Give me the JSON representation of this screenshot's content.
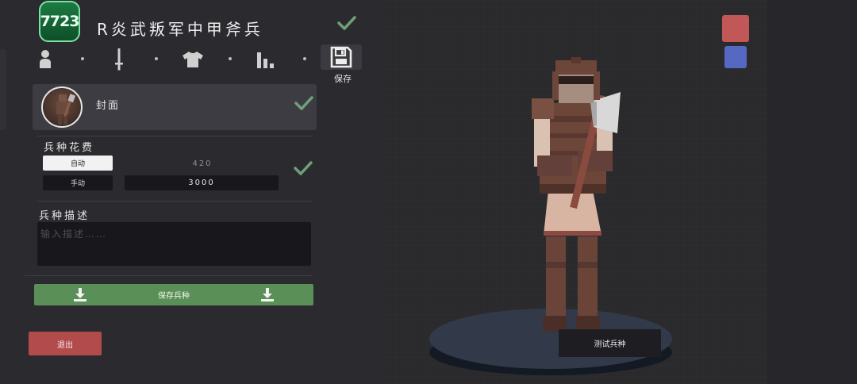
{
  "header": {
    "badge": "7723",
    "title": "R炎武叛军中甲斧兵"
  },
  "tabs": [
    {
      "icon": "person-icon"
    },
    {
      "icon": "sword-icon"
    },
    {
      "icon": "shirt-icon"
    },
    {
      "icon": "stats-icon"
    },
    {
      "icon": "save-disk-icon",
      "label": "保存"
    }
  ],
  "cover": {
    "label": "封面"
  },
  "cost": {
    "label": "兵种花费",
    "auto_label": "自动",
    "manual_label": "手动",
    "auto_value": "420",
    "manual_value": "3000"
  },
  "description": {
    "label": "兵种描述",
    "placeholder": "输入描述……"
  },
  "actions": {
    "save_unit": "保存兵种",
    "exit": "退出",
    "test_unit": "测试兵种"
  },
  "colors": {
    "accent_green": "#5a8f57",
    "exit_red": "#b24c4c",
    "team_red": "#c25757",
    "team_blue": "#5569c2",
    "check_green": "#6fbf7d"
  }
}
